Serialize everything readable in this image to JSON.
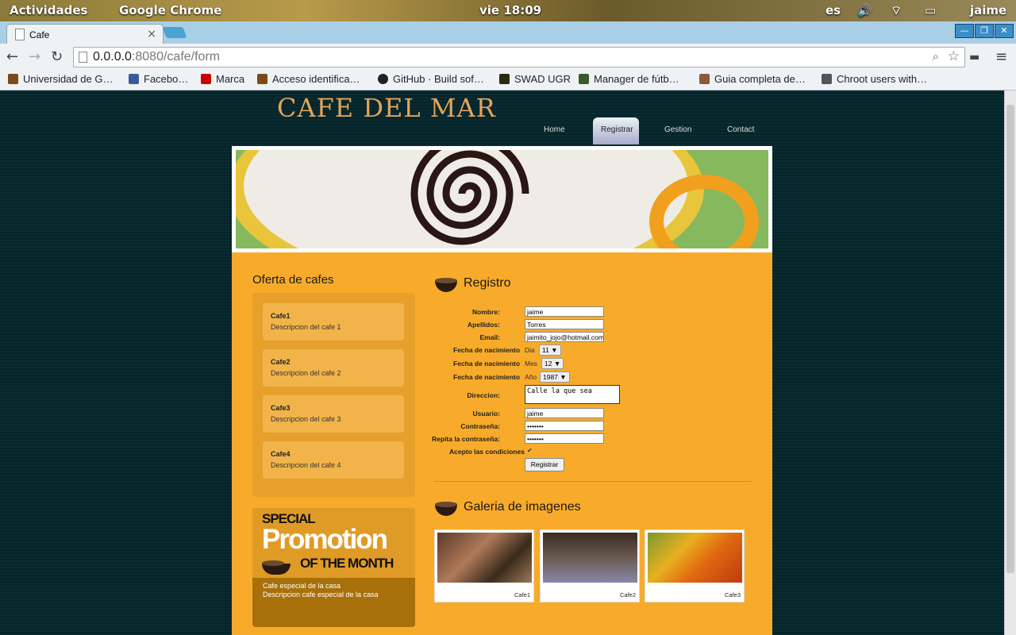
{
  "desktop": {
    "activities": "Actividades",
    "app": "Google Chrome",
    "clock": "vie 18:09",
    "lang": "es",
    "user": "jaime"
  },
  "browser": {
    "tab_title": "Cafe",
    "url_host": "0.0.0.0",
    "url_rest": ":8080/cafe/form",
    "bookmarks": [
      "Universidad de G…",
      "Facebo…",
      "Marca",
      "Acceso identifica…",
      "GitHub · Build sof…",
      "SWAD UGR",
      "Manager de fútb…",
      "Guia completa de…",
      "Chroot users with…"
    ]
  },
  "site": {
    "logo": "CAFE DEL MAR",
    "nav": [
      "Home",
      "Registrar",
      "Gestion",
      "Contact"
    ]
  },
  "sidebar": {
    "title": "Oferta de cafes",
    "items": [
      {
        "name": "Cafe1",
        "desc": "Descripcion del cafe 1"
      },
      {
        "name": "Cafe2",
        "desc": "Descripcion del cafe 2"
      },
      {
        "name": "Cafe3",
        "desc": "Descripcion del cafe 3"
      },
      {
        "name": "Cafe4",
        "desc": "Descripcion del cafe 4"
      }
    ],
    "promo": {
      "special": "SPECIAL",
      "promotion": "Promotion",
      "month": "OF THE MONTH",
      "line1": "Cafe especial de la casa",
      "line2": "Descripcion cafe especial de la casa"
    }
  },
  "form": {
    "title": "Registro",
    "nombre_label": "Nombre:",
    "nombre": "jaime",
    "apellidos_label": "Apellidos:",
    "apellidos": "Torres",
    "email_label": "Email:",
    "email": "jaimito_jojo@hotmail.com",
    "fecha_label": "Fecha de nacimiento",
    "dia_label": "Dia",
    "dia": "11 ▼",
    "mes_label": "Mes",
    "mes": "12 ▼",
    "anio_label": "Año",
    "anio": "1987 ▼",
    "direccion_label": "Direccion:",
    "direccion": "Calle la que sea",
    "usuario_label": "Usuario:",
    "usuario": "jaime",
    "pass_label": "Contraseña:",
    "pass": "•••••••",
    "repass_label": "Repita la contraseña:",
    "repass": "•••••••",
    "acepto_label": "Acepto las condiciones",
    "check": "✔",
    "submit": "Registrar"
  },
  "gallery": {
    "title": "Galeria de imagenes",
    "items": [
      "Cafe1",
      "Cafe2",
      "Cafe3"
    ]
  }
}
